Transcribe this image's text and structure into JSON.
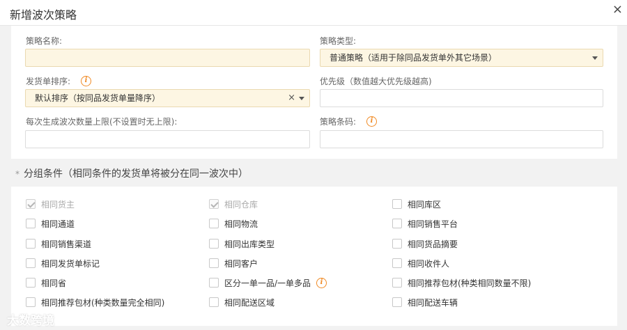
{
  "dialog": {
    "title": "新增波次策略",
    "close_glyph": "×"
  },
  "form": {
    "name_label": "策略名称:",
    "name_value": "",
    "type_label": "策略类型:",
    "type_value": "普通策略（适用于除同品发货单外其它场景）",
    "order_label": "发货单排序:",
    "order_value": "默认排序（按同品发货单量降序）",
    "priority_label": "优先级（数值越大优先级越高)",
    "priority_value": "",
    "limit_label": "每次生成波次数量上限(不设置时无上限):",
    "limit_value": "",
    "barcode_label": "策略条码:",
    "barcode_value": ""
  },
  "groups": {
    "star": "*",
    "title": "分组条件（相同条件的发货单将被分在同一波次中）",
    "options": [
      {
        "label": "相同货主",
        "checked": true
      },
      {
        "label": "相同仓库",
        "checked": true
      },
      {
        "label": "相同库区",
        "checked": false
      },
      {
        "label": "相同通道",
        "checked": false
      },
      {
        "label": "相同物流",
        "checked": false
      },
      {
        "label": "相同销售平台",
        "checked": false
      },
      {
        "label": "相同销售渠道",
        "checked": false
      },
      {
        "label": "相同出库类型",
        "checked": false
      },
      {
        "label": "相同货品摘要",
        "checked": false
      },
      {
        "label": "相同发货单标记",
        "checked": false
      },
      {
        "label": "相同客户",
        "checked": false
      },
      {
        "label": "相同收件人",
        "checked": false
      },
      {
        "label": "相同省",
        "checked": false
      },
      {
        "label": "区分一单一品/一单多品",
        "checked": false
      },
      {
        "label": "相同推荐包材(种类相同数量不限)",
        "checked": false
      },
      {
        "label": "相同推荐包材(种类数量完全相同)",
        "checked": false
      },
      {
        "label": "相同配送区域",
        "checked": false
      },
      {
        "label": "相同配送车辆",
        "checked": false
      }
    ]
  },
  "icons": {
    "info": "i",
    "clear": "×"
  },
  "watermark": "大数跨境",
  "colors": {
    "accent_orange": "#f08a24",
    "highlight_bg": "#fdf6e3"
  }
}
